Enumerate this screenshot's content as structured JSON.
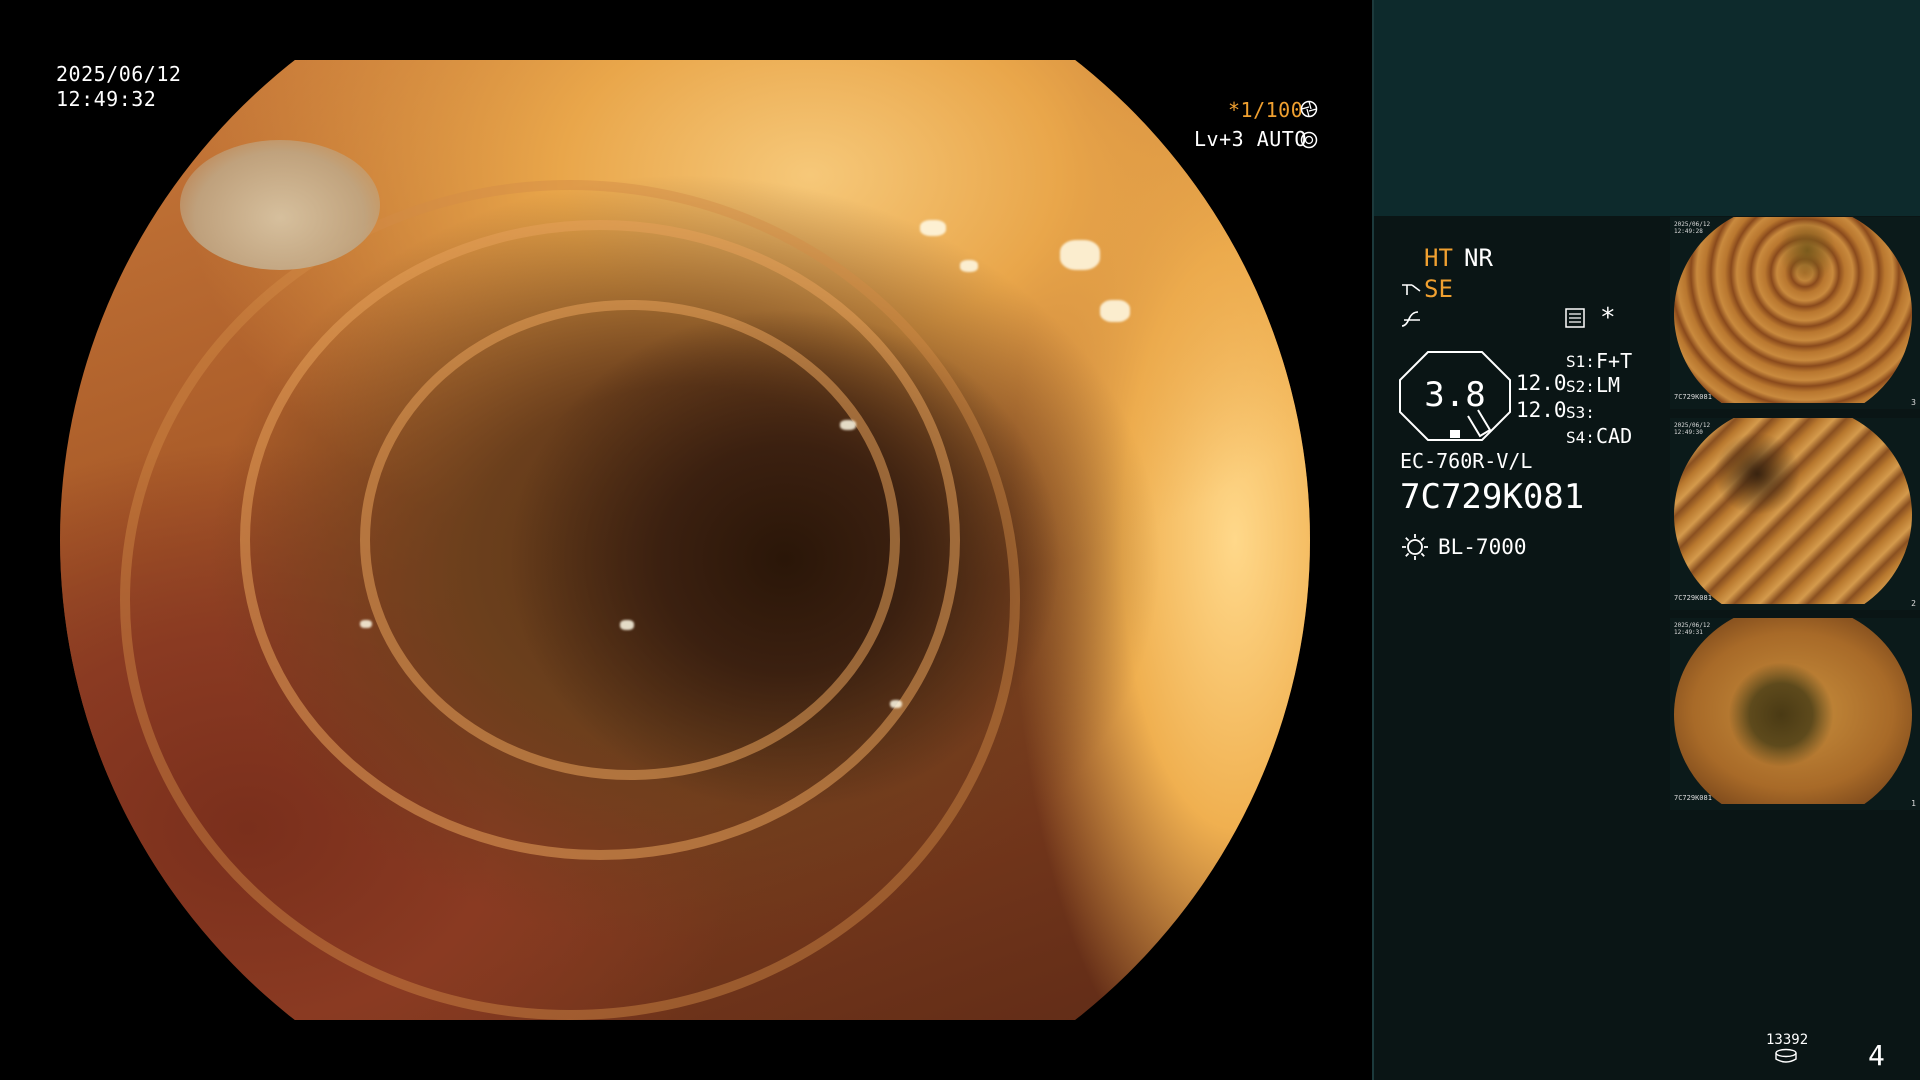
{
  "osd": {
    "date": "2025/06/12",
    "time": "12:49:32",
    "shutter": "*1/100",
    "shutter_icon": "aperture-icon",
    "level": "Lv+3 AUTO",
    "auto_icon": "iris-icon"
  },
  "panel": {
    "ht": "HT",
    "nr": "NR",
    "se": "SE",
    "se_icon": "structure-enhance-icon",
    "wave_icon": "freeze-wave-icon",
    "menu_icon": "menu-list-icon",
    "star": "*",
    "zoom_value": "3.8",
    "value_1": "12.0",
    "value_2": "12.0",
    "switches": [
      {
        "label": "S1:",
        "value": "F+T"
      },
      {
        "label": "S2:",
        "value": "LM"
      },
      {
        "label": "S3:",
        "value": ""
      },
      {
        "label": "S4:",
        "value": "CAD"
      }
    ],
    "scope_model": "EC-760R-V/L",
    "scope_serial": "7C729K081",
    "light_icon": "light-source-icon",
    "light_model": "BL-7000"
  },
  "thumbnails": [
    {
      "date": "2025/06/12\n12:49:28",
      "serial": "7C729K081",
      "number": "3"
    },
    {
      "date": "2025/06/12\n12:49:30",
      "serial": "7C729K081",
      "number": "2"
    },
    {
      "date": "2025/06/12\n12:49:31",
      "serial": "7C729K081",
      "number": "1"
    }
  ],
  "footer": {
    "capture_count": "13392",
    "disk_icon": "storage-disk-icon",
    "page_number": "4"
  },
  "colors": {
    "accent": "#f0a030",
    "panel_top": "#0d2a2c",
    "panel_main": "#0a1515",
    "text": "#ffffff"
  }
}
